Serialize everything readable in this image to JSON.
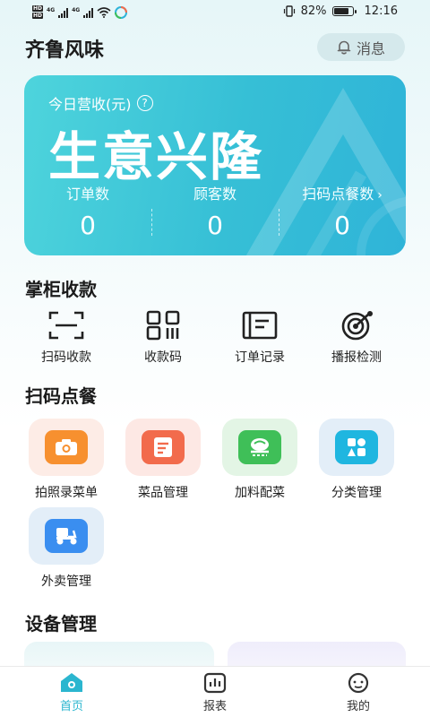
{
  "status_bar": {
    "hd1": "HD",
    "hd2": "HD",
    "net1": "4G",
    "net2": "4G",
    "battery_text": "82%",
    "battery_level": 0.82,
    "time": "12:16"
  },
  "header": {
    "title": "齐鲁风味",
    "message_label": "消息"
  },
  "banner": {
    "revenue_label": "今日营收(元)",
    "help_glyph": "?",
    "slogan": "生意兴隆",
    "stats": [
      {
        "label": "订单数",
        "value": "0"
      },
      {
        "label": "顾客数",
        "value": "0"
      },
      {
        "label": "扫码点餐数",
        "value": "0"
      }
    ]
  },
  "payment_section": {
    "title": "掌柜收款",
    "items": [
      {
        "label": "扫码收款",
        "icon": "scan-icon"
      },
      {
        "label": "收款码",
        "icon": "qrcode-icon"
      },
      {
        "label": "订单记录",
        "icon": "order-record-icon"
      },
      {
        "label": "播报检测",
        "icon": "broadcast-test-icon"
      }
    ]
  },
  "ordering_section": {
    "title": "扫码点餐",
    "items": [
      {
        "label": "拍照录菜单",
        "icon": "camera-icon",
        "tile_bg": "#fdece6",
        "inner_bg": "#f7902f"
      },
      {
        "label": "菜品管理",
        "icon": "dish-doc-icon",
        "tile_bg": "#fde8e4",
        "inner_bg": "#f26b4c"
      },
      {
        "label": "加料配菜",
        "icon": "bowl-icon",
        "tile_bg": "#e3f5e5",
        "inner_bg": "#3fbf58"
      },
      {
        "label": "分类管理",
        "icon": "category-icon",
        "tile_bg": "#e3eef8",
        "inner_bg": "#1fb6e0"
      },
      {
        "label": "外卖管理",
        "icon": "scooter-icon",
        "tile_bg": "#e3eef8",
        "inner_bg": "#3a8ef0"
      }
    ]
  },
  "device_section": {
    "title": "设备管理"
  },
  "bottom_nav": {
    "items": [
      {
        "label": "首页",
        "icon": "home-icon",
        "active": true
      },
      {
        "label": "报表",
        "icon": "report-icon",
        "active": false
      },
      {
        "label": "我的",
        "icon": "profile-icon",
        "active": false
      }
    ]
  },
  "colors": {
    "accent": "#2bb6cf",
    "banner_start": "#4ed4dc",
    "banner_end": "#2fb4d8"
  }
}
